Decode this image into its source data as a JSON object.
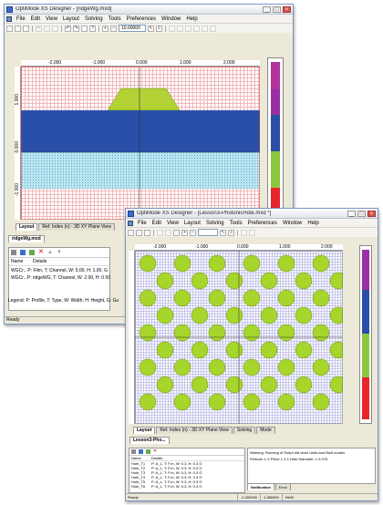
{
  "win1": {
    "title": "OptiMode XS Designer - [ridgeWg.mxd]",
    "menu": [
      "File",
      "Edit",
      "View",
      "Layout",
      "Solving",
      "Tools",
      "Preferences",
      "Window",
      "Help"
    ],
    "zoom": "10.00000",
    "ruler_x": [
      "-2.000",
      "-1.000",
      "0.000",
      "1.000",
      "2.000"
    ],
    "ruler_y": [
      "1.000",
      "0.000",
      "-1.000"
    ],
    "colorbar": [
      "#b2349a",
      "#9b2ea4",
      "#2a4fa8",
      "#8dc63f",
      "#e8252b"
    ],
    "tabs": [
      "Layout",
      "Ref. Index (n) - 3D XY Plane View"
    ],
    "doc_tab": "ridgeWg.mxd",
    "list_header": [
      "Name",
      "Details"
    ],
    "rows": [
      {
        "name": "WGCr...",
        "details": "P: Film, T: Channel, W: 5.00, H: 1.00, G"
      },
      {
        "name": "WGCr...",
        "details": "P: ridgeWG, T: Channel, W: 2.00, H: 0.50"
      }
    ],
    "legend": "Legend: P: Profile, T: Type, W: Width, H: Height, G: Gu",
    "status": "Ready",
    "colors": {
      "ridge": "#b2d235",
      "core": "#2a4fa8",
      "substrate": "#8fd6e8"
    }
  },
  "win2": {
    "title": "OptiMode XS Designer - [Lesson3-PhotonicHole.mxd *]",
    "menu": [
      "File",
      "Edit",
      "View",
      "Layout",
      "Solving",
      "Tools",
      "Preferences",
      "Window",
      "Help"
    ],
    "ruler_x": [
      "-2.000",
      "-1.000",
      "0.000",
      "1.000",
      "2.000"
    ],
    "tabs": [
      "Layout",
      "Ref. Index (n) - 3D XY Plane View",
      "Solving",
      "Mode"
    ],
    "doc_tab": "Lesson3-Pho...",
    "list_header": [
      "Name",
      "Details"
    ],
    "rows": [
      {
        "name": "Hole_T1",
        "details": "P: A_L, T: F.m, W: 0.3, H: 0.3 G"
      },
      {
        "name": "Hole_T2",
        "details": "P: A_L, T: F.m, W: 0.3, H: 0.3 G"
      },
      {
        "name": "Hole_T3",
        "details": "P: A_L, T: F.m, W: 0.3, H: 0.3 G"
      },
      {
        "name": "Hole_T4",
        "details": "P: A_L, T: F.m, W: 0.3, H: 0.3 G"
      },
      {
        "name": "Hole_T5",
        "details": "P: A_L, T: F.m, W: 0.3, H: 0.3 G"
      },
      {
        "name": "Hole_T6",
        "details": "P: A_L, T: F.m, W: 0.3, H: 0.3 G"
      }
    ],
    "message_title": "Warning: Running of Script will clear Units and Built modes",
    "message_body": "Periods: L.X   Pitch: L.2.1   Hole Diameter: L.0.075",
    "msg_tabs": [
      "Notification",
      "Error"
    ],
    "status": [
      "Ready",
      "-1.000000",
      "1.380000",
      "NUM"
    ],
    "colorbar": [
      "#9b2ea4",
      "#2a4fa8",
      "#8dc63f",
      "#e8252b"
    ],
    "hole_color": "#a6d52b"
  }
}
